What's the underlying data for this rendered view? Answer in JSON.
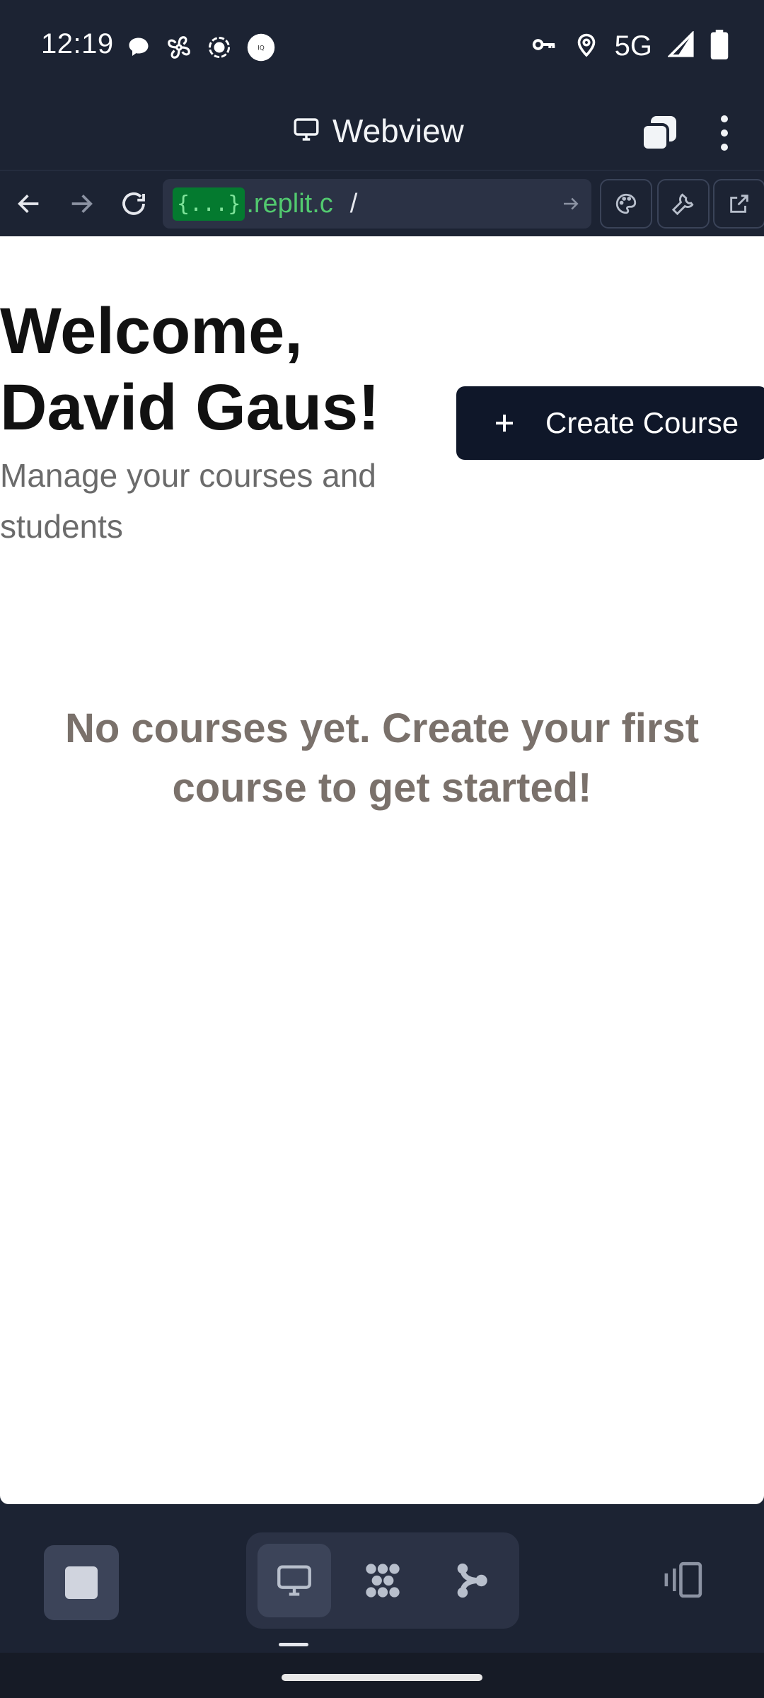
{
  "status_bar": {
    "time": "12:19",
    "network": "5G",
    "left_icons": [
      "chat-bubble-icon",
      "fan-icon",
      "record-icon",
      "app-badge-icon"
    ],
    "right_icons": [
      "vpn-key-icon",
      "location-icon",
      "signal-icon",
      "battery-icon"
    ]
  },
  "title_bar": {
    "title": "Webview",
    "icon": "monitor-icon"
  },
  "url_bar": {
    "badge": "{...}",
    "domain": ".replit.c",
    "path": "/"
  },
  "page": {
    "welcome_line1": "Welcome,",
    "welcome_line2": "David Gaus!",
    "subtitle": "Manage your courses and students",
    "create_button_label": "Create Course",
    "empty_message": "No courses yet. Create your first course to get started!"
  },
  "bottom_bar": {
    "segments": [
      "monitor-icon",
      "agent-dots-icon",
      "branch-icon"
    ],
    "active_segment": "monitor-icon"
  },
  "colors": {
    "app_bg": "#1c2333",
    "button_bg": "#0f1729",
    "url_green": "#52c96f",
    "empty_text": "#7a716b"
  }
}
